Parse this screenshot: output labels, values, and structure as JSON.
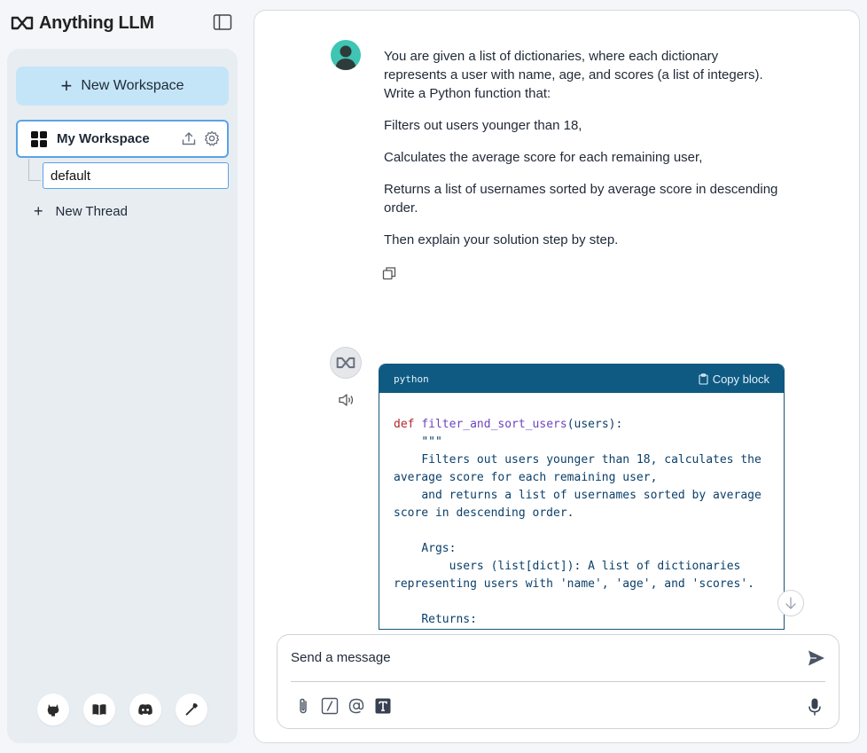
{
  "app": {
    "brand": "Anything LLM"
  },
  "sidebar": {
    "new_workspace_label": "New Workspace",
    "workspace_name": "My Workspace",
    "thread_name": "default",
    "new_thread_label": "New Thread",
    "footer_icons": [
      "github-icon",
      "book-icon",
      "discord-icon",
      "wrench-icon"
    ]
  },
  "chat": {
    "user_message": {
      "paragraphs": [
        "You are given a list of dictionaries, where each dictionary represents a user with name, age, and scores (a list of integers). Write a Python function that:",
        "Filters out users younger than 18,",
        "Calculates the average score for each remaining user,",
        "Returns a list of usernames sorted by average score in descending order.",
        "Then explain your solution step by step."
      ]
    },
    "assistant_message": {
      "code_language": "python",
      "copy_label": "Copy block",
      "code": {
        "def": "def",
        "fn_name": "filter_and_sort_users",
        "signature_rest": "(users):",
        "body": "    \"\"\"\n    Filters out users younger than 18, calculates the average score for each remaining user,\n    and returns a list of usernames sorted by average score in descending order.\n\n    Args:\n        users (list[dict]): A list of dictionaries representing users with 'name', 'age', and 'scores'.\n\n    Returns:"
      }
    }
  },
  "composer": {
    "placeholder": "Send a message"
  },
  "colors": {
    "accent": "#c4e5f7",
    "selected_border": "#5ba3e6",
    "code_header": "#0e5a82",
    "avatar": "#3ec5b4"
  }
}
